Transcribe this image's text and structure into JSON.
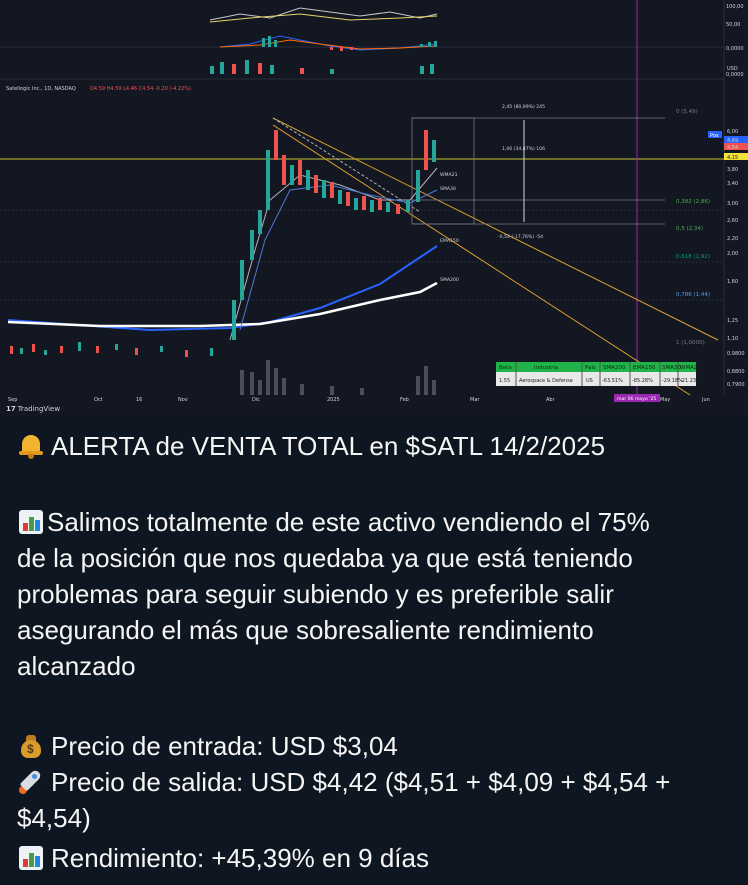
{
  "screenshot": {
    "chart": {
      "symbol_line": "Satellogic Inc., 1D, NASDAQ",
      "ohlc_line": "O4.59 H4.59 L4.46 C4.54 -0.20 (-4.22%)",
      "currency_badge": "USD",
      "top_scale_labels": [
        "100,00",
        "50,00",
        "0,0000",
        "0,0000"
      ],
      "price_axis_labels": [
        "6,00",
        "4,69",
        "4,54",
        "4,15",
        "3,80",
        "3,40",
        "3,00",
        "2,60",
        "2,20",
        "2,00",
        "1,60",
        "1,25",
        "1,10",
        "0,9800",
        "0,8800",
        "0,7900"
      ],
      "time_axis_labels": [
        "Sep",
        "Oct",
        "16",
        "Nov",
        "Dic",
        "2025",
        "Feb",
        "Mar",
        "Abr",
        "May",
        "Jun"
      ],
      "date_badge": "mar 06 mayo '25",
      "pos_badge": "Pos",
      "fib_levels": [
        "0 (5,49)",
        "0,382 (2,86)",
        "0,5 (2,34)",
        "0,618 (1,92)",
        "0,786 (1,44)",
        "1 (1,0000)"
      ],
      "measure_labels": [
        "2,45 (80,99%) 245",
        "1,06 (34,87%) 106",
        "-0,54 (-17,76%) -54"
      ],
      "ma_labels": [
        "WMA21",
        "SMA30",
        "EMA150",
        "SMA200"
      ],
      "table_headers": [
        "Beta",
        "Industria",
        "País",
        "SMA200",
        "EMA150",
        "SMA30",
        "WMA21"
      ],
      "table_values": [
        "1.55",
        "Aerospace & Defense",
        "US",
        "-63.51%",
        "-85.28%",
        "-29.18%",
        "-21.23%"
      ],
      "watermark": "TradingView"
    },
    "message": {
      "alert_line": "ALERTA de VENTA TOTAL en $SATL 14/2/2025",
      "body_lines": [
        "Salimos totalmente de este activo vendiendo el 75%",
        "de la posición que nos quedaba ya que está teniendo",
        "problemas para seguir subiendo y es preferible salir",
        "asegurando el más que sobresaliente rendimiento",
        "alcanzado"
      ],
      "entry_line": "Precio de entrada: USD  $3,04",
      "exit_line_1": "Precio de salida: USD  $4,42 ($4,51 + $4,09 + $4,54 +",
      "exit_line_2": "$4,54)",
      "return_line": "Rendimiento: +45,39% en 9 días"
    },
    "icons": {
      "alert": "bell-icon",
      "body": "bar-chart-icon",
      "entry": "money-bag-icon",
      "exit": "rocket-icon",
      "return": "bar-chart-icon"
    }
  }
}
